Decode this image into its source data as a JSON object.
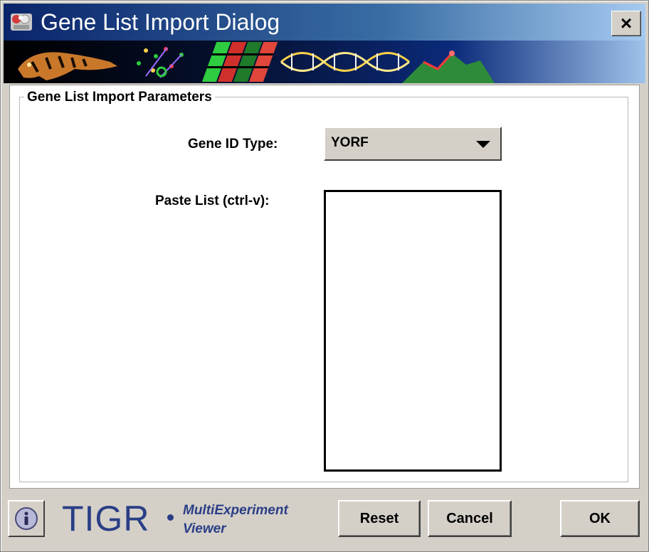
{
  "window": {
    "title": "Gene List Import Dialog",
    "close_label": "×"
  },
  "banner": {
    "accent_colors": [
      "#0a246a",
      "#d0302c",
      "#2e8b3a",
      "#ffd24a"
    ]
  },
  "panel": {
    "group_title": "Gene List Import Parameters",
    "gene_id_type_label": "Gene ID Type:",
    "gene_id_type_value": "YORF",
    "paste_label": "Paste List (ctrl-v):",
    "paste_value": ""
  },
  "footer": {
    "info_icon": "info-icon",
    "logo_text": "TIGR",
    "logo_subtitle_line1": "MultiExperiment",
    "logo_subtitle_line2": "Viewer",
    "reset_label": "Reset",
    "cancel_label": "Cancel",
    "ok_label": "OK"
  }
}
